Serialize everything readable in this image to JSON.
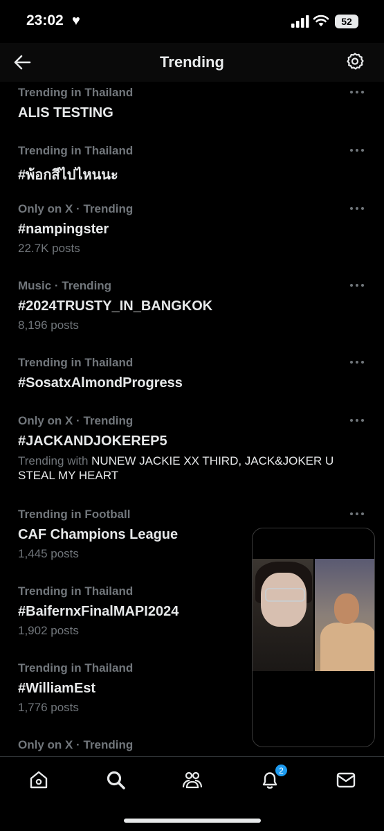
{
  "status_bar": {
    "time": "23:02",
    "battery": "52",
    "heart_icon": "heart-icon"
  },
  "header": {
    "title": "Trending",
    "back_icon": "arrow-left-icon",
    "settings_icon": "gear-icon"
  },
  "trends": [
    {
      "context": "Trending in Thailand",
      "title": "ALIS TESTING",
      "posts": ""
    },
    {
      "context": "Trending in Thailand",
      "title": "#พ้อกสีไปไหนนะ",
      "posts": ""
    },
    {
      "context": "Only on X · Trending",
      "title": "#nampingster",
      "posts": "22.7K posts"
    },
    {
      "context": "Music · Trending",
      "title": "#2024TRUSTY_IN_BANGKOK",
      "posts": "8,196 posts"
    },
    {
      "context": "Trending in Thailand",
      "title": "#SosatxAlmondProgress",
      "posts": ""
    },
    {
      "context": "Only on X · Trending",
      "title": "#JACKANDJOKEREP5",
      "posts": "",
      "with_label": "Trending with",
      "with_text": "NUNEW JACKIE XX THIRD, JACK&JOKER U STEAL MY HEART"
    },
    {
      "context": "Trending in Football",
      "title": "CAF Champions League",
      "posts": "1,445 posts"
    },
    {
      "context": "Trending in Thailand",
      "title": "#BaifernxFinalMAPI2024",
      "posts": "1,902 posts"
    },
    {
      "context": "Trending in Thailand",
      "title": "#WilliamEst",
      "posts": "1,776 posts"
    },
    {
      "context": "Only on X · Trending",
      "title": "",
      "posts": ""
    }
  ],
  "tab_bar": {
    "tabs": [
      "home-icon",
      "search-icon",
      "communities-icon",
      "notifications-icon",
      "messages-icon"
    ],
    "notifications_badge": "2"
  },
  "colors": {
    "background": "#000000",
    "text": "#e7e9ea",
    "muted": "#71767b",
    "accent": "#1d9bf0"
  }
}
